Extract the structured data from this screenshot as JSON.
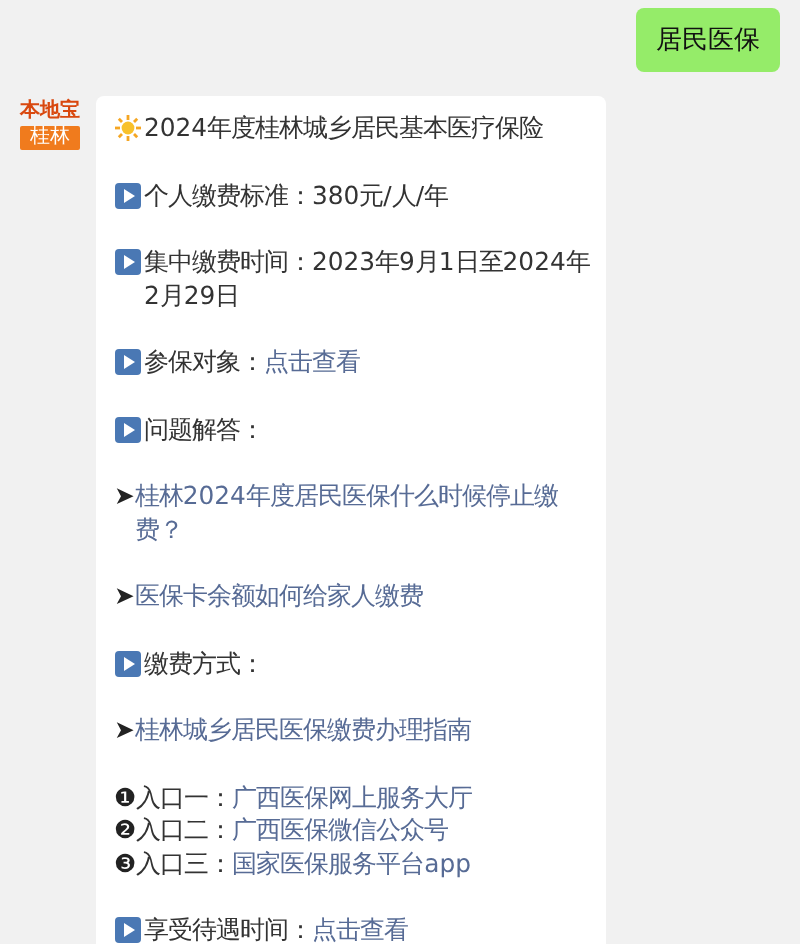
{
  "outgoing_message": {
    "text": "居民医保"
  },
  "sender": {
    "logo_text": "本地宝",
    "city_label": "桂林"
  },
  "incoming_message": {
    "items": [
      {
        "kind": "heading",
        "text": "2024年度桂林城乡居民基本医疗保险"
      },
      {
        "kind": "bullet",
        "text": "个人缴费标准：380元/人/年"
      },
      {
        "kind": "bullet",
        "text": "集中缴费时间：2023年9月1日至2024年2月29日"
      },
      {
        "kind": "bullet",
        "text": "参保对象：",
        "link": "点击查看"
      },
      {
        "kind": "bullet",
        "text": "问题解答："
      },
      {
        "kind": "arrow",
        "marker": "➤",
        "link": "桂林2024年度居民医保什么时候停止缴费？"
      },
      {
        "kind": "arrow",
        "marker": "➤",
        "link": "医保卡余额如何给家人缴费"
      },
      {
        "kind": "bullet",
        "text": "缴费方式："
      },
      {
        "kind": "arrow",
        "marker": "➤",
        "link": "桂林城乡居民医保缴费办理指南"
      },
      {
        "kind": "entry",
        "marker": "❶",
        "text": "入口一：",
        "link": "广西医保网上服务大厅"
      },
      {
        "kind": "entry",
        "marker": "❷",
        "text": "入口二：",
        "link": "广西医保微信公众号"
      },
      {
        "kind": "entry",
        "marker": "❸",
        "text": "入口三：",
        "link": "国家医保服务平台app"
      },
      {
        "kind": "bullet",
        "text": "享受待遇时间：",
        "link": "点击查看"
      }
    ]
  }
}
